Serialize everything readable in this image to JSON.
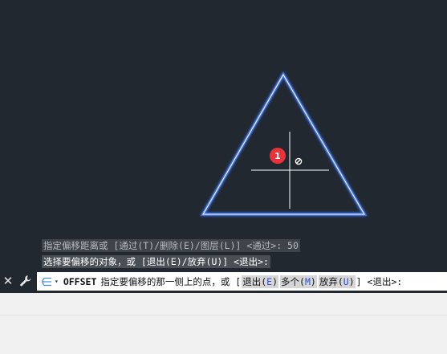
{
  "history": [
    "指定偏移距离或 [通过(T)/删除(E)/图层(L)] <通过>: 50",
    "选择要偏移的对象，或 [退出(E)/放弃(U)] <退出>:"
  ],
  "marker": {
    "number": "1",
    "color": "#e8333a"
  },
  "command": {
    "close_glyph": "✕",
    "caret_glyph": "▾",
    "name": "OFFSET",
    "prompt": "指定要偏移的那一侧上的点，或 [",
    "options": [
      {
        "pre": "退出(",
        "key": "E",
        "post": ")"
      },
      {
        "pre": "多个(",
        "key": "M",
        "post": ")"
      },
      {
        "pre": "放弃(",
        "key": "U",
        "post": ")"
      }
    ],
    "suffix": "] <退出>:"
  },
  "colors": {
    "canvas": "#212830",
    "triangle_outline": "#dfe8ff",
    "triangle_glow": "#3f73e6",
    "crosshair": "#ffffff",
    "option_key": "#2b4fd8"
  },
  "icons": {
    "close": "close-icon",
    "wrench": "wrench-icon",
    "prompt": "command-prompt-icon",
    "pickbox": "pickbox-cursor-icon"
  }
}
